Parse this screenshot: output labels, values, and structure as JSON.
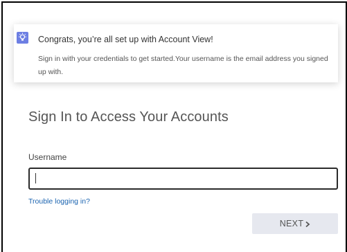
{
  "notice": {
    "icon": "lightbulb-icon",
    "icon_color": "#6d7fe3",
    "title": "Congrats, you’re all set up with Account View!",
    "body": "Sign in with your credentials to get started.Your username is the email address you signed up with."
  },
  "signin": {
    "heading": "Sign In to Access Your Accounts",
    "username_label": "Username",
    "username_value": "",
    "trouble_link": "Trouble logging in?",
    "next_label": "NEXT",
    "next_icon": "chevron-right-icon"
  },
  "colors": {
    "link": "#1a63b0",
    "button_bg": "#e6e8ef",
    "input_border": "#2a2a2a"
  }
}
